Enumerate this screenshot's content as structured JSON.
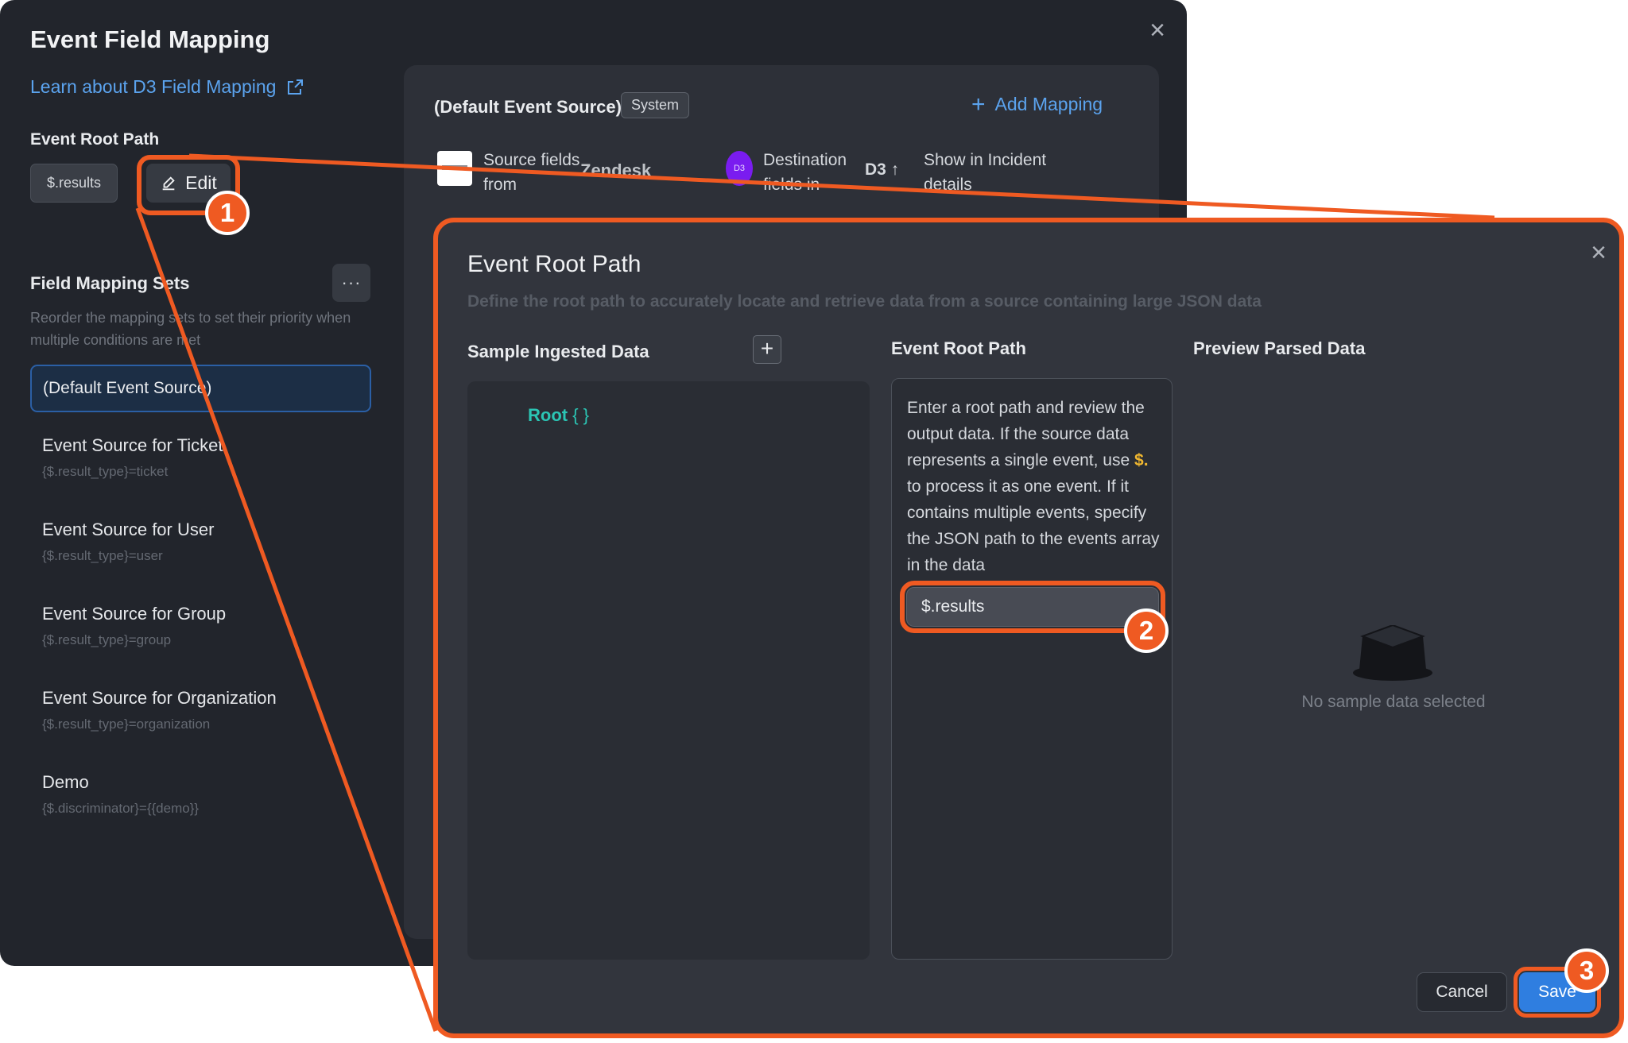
{
  "main": {
    "title": "Event Field Mapping",
    "learn_link": "Learn about D3 Field Mapping",
    "root_label": "Event Root Path",
    "root_value": "$.results",
    "edit_label": "Edit",
    "sets_title": "Field Mapping Sets",
    "sets_desc": "Reorder the mapping sets to set their priority when multiple conditions are met",
    "more_label": "···",
    "sets": [
      {
        "name": "(Default Event Source)"
      },
      {
        "name": "Event Source for Ticket",
        "cond": "{$.result_type}=ticket"
      },
      {
        "name": "Event Source for User",
        "cond": "{$.result_type}=user"
      },
      {
        "name": "Event Source for Group",
        "cond": "{$.result_type}=group"
      },
      {
        "name": "Event Source for Organization",
        "cond": "{$.result_type}=organization"
      },
      {
        "name": "Demo",
        "cond": "{$.discriminator}={{demo}}"
      }
    ],
    "panel": {
      "title": "(Default Event Source)",
      "badge": "System",
      "add_mapping": "Add Mapping",
      "source_label": "Source fields from",
      "source_name": "Zendesk",
      "dest_label": "Destination fields in",
      "dest_name": "D3 ↑",
      "dest_logo": "D3",
      "show_label": "Show in Incident details"
    }
  },
  "modal": {
    "title": "Event Root Path",
    "description": "Define the root path to accurately locate and retrieve data from a source containing large JSON data",
    "col_sample": "Sample Ingested Data",
    "col_path": "Event Root Path",
    "col_preview": "Preview Parsed Data",
    "root_node": "Root",
    "root_braces": "{ }",
    "help_1": "Enter a root path and review the output data. If the source data represents a single event, use ",
    "help_accent": "$.",
    "help_2": " to process it as one event. If it contains multiple events, specify the JSON path to the events array in the data",
    "path_value": "$.results",
    "empty_text": "No sample data selected",
    "cancel": "Cancel",
    "save": "Save"
  },
  "steps": [
    "1",
    "2",
    "3"
  ],
  "colors": {
    "accent": "#ef5a22",
    "link": "#5ba3ee",
    "primary": "#2f7ee0",
    "json_key": "#2bc5b4"
  }
}
